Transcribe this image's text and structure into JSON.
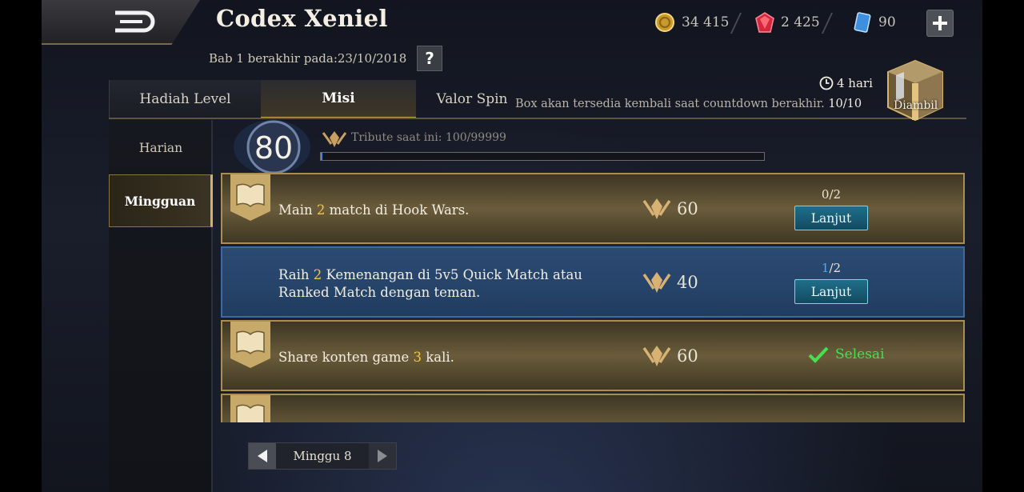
{
  "header": {
    "title": "Codex Xeniel",
    "resources": [
      {
        "name": "gold",
        "icon": "gold-coin-icon",
        "value": "34 415",
        "color": "#d6b24a"
      },
      {
        "name": "diamond",
        "icon": "red-diamond-icon",
        "value": "2 425",
        "color": "#d6283c"
      },
      {
        "name": "voucher",
        "icon": "blue-ticket-icon",
        "value": "90",
        "color": "#3f8fe0"
      }
    ],
    "season_end": "Bab 1 berakhir pada:23/10/2018",
    "help_label": "?"
  },
  "tabs": [
    {
      "label": "Hadiah Level"
    },
    {
      "label": "Misi"
    },
    {
      "label": "Valor Spin"
    }
  ],
  "box": {
    "countdown": "4 hari",
    "note": "Box akan tersedia kembali saat countdown berakhir.",
    "count": "10/10",
    "claim_label": "Diambil"
  },
  "sidebar": [
    {
      "label": "Harian"
    },
    {
      "label": "Mingguan"
    }
  ],
  "tribute": {
    "level": "80",
    "label": "Tribute saat ini: 100/99999",
    "progress": 0.001,
    "bar_color": "#4b86d6"
  },
  "missions": [
    {
      "text_pre": "Main ",
      "num": "2",
      "text_post": " match di Hook Wars.",
      "reward": "60",
      "prog_cur": "0",
      "prog_tot": "/2",
      "action": "Lanjut",
      "state": "active",
      "style": "gold"
    },
    {
      "text_pre": "Raih ",
      "num": "2",
      "text_post": " Kemenangan di 5v5 Quick Match atau Ranked Match dengan teman.",
      "reward": "40",
      "prog_cur": "1",
      "prog_tot": "/2",
      "action": "Lanjut",
      "state": "active",
      "style": "blue"
    },
    {
      "text_pre": "Share konten game ",
      "num": "3",
      "text_post": " kali.",
      "reward": "60",
      "prog_cur": "",
      "prog_tot": "",
      "action": "Selesai",
      "state": "done",
      "style": "gold"
    },
    {
      "text_pre": "",
      "num": "",
      "text_post": "",
      "reward": "",
      "prog_cur": "",
      "prog_tot": "",
      "action": "",
      "state": "partial",
      "style": "gold"
    }
  ],
  "week": {
    "label": "Minggu 8"
  }
}
